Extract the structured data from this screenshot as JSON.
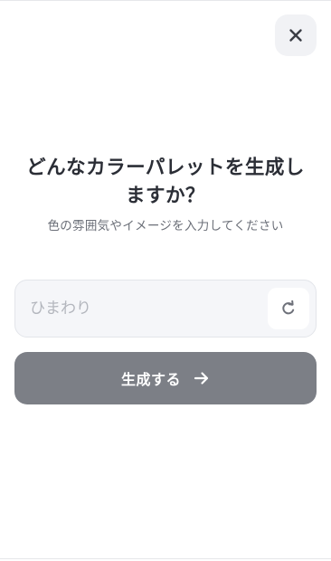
{
  "dialog": {
    "title_line1": "どんなカラーパレットを生成し",
    "title_line2": "ますか？",
    "subtitle": "色の雰囲気やイメージを入力してください",
    "input": {
      "value": "",
      "placeholder": "ひまわり"
    },
    "generate_label": "生成する"
  },
  "icons": {
    "close": "close-icon",
    "refresh": "refresh-icon",
    "arrow": "arrow-right-icon"
  },
  "colors": {
    "background": "#ffffff",
    "close_button_bg": "#f1f2f5",
    "input_bg": "#f5f6f9",
    "primary_button_bg": "#7c7f86",
    "primary_button_text": "#ffffff",
    "title_text": "#2b2e36",
    "subtitle_text": "#6b6f78",
    "placeholder_text": "#b3b6bd"
  }
}
